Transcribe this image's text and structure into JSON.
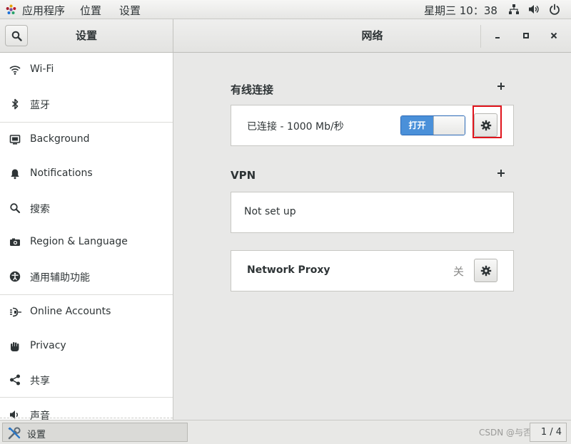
{
  "topbar": {
    "apps_label": "应用程序",
    "places_label": "位置",
    "settings_label": "设置",
    "clock": "星期三 10：38",
    "icons": [
      "network-icon",
      "volume-icon",
      "power-icon"
    ]
  },
  "header": {
    "left_title": "设置",
    "right_title": "网络"
  },
  "sidebar": {
    "items": [
      {
        "label": "Wi-Fi",
        "icon": "wifi-icon"
      },
      {
        "label": "蓝牙",
        "icon": "bluetooth-icon"
      },
      {
        "label": "Background",
        "icon": "background-icon"
      },
      {
        "label": "Notifications",
        "icon": "bell-icon"
      },
      {
        "label": "搜索",
        "icon": "search-icon"
      },
      {
        "label": "Region & Language",
        "icon": "camera-icon"
      },
      {
        "label": "通用辅助功能",
        "icon": "accessibility-icon"
      },
      {
        "label": "Online Accounts",
        "icon": "online-accounts-icon"
      },
      {
        "label": "Privacy",
        "icon": "hand-icon"
      },
      {
        "label": "共享",
        "icon": "share-icon"
      },
      {
        "label": "声音",
        "icon": "speaker-icon"
      }
    ]
  },
  "wired": {
    "title": "有线连接",
    "status": "已连接 - 1000 Mb/秒",
    "switch_label": "打开"
  },
  "vpn": {
    "title": "VPN",
    "status": "Not set up"
  },
  "proxy": {
    "label": "Network Proxy",
    "state": "关"
  },
  "taskbar": {
    "task_label": "设置",
    "watermark": "CSDN @与否",
    "pager": "1 / 4"
  },
  "colors": {
    "switch_on": "#4a90d9",
    "highlight": "#e0141c"
  }
}
